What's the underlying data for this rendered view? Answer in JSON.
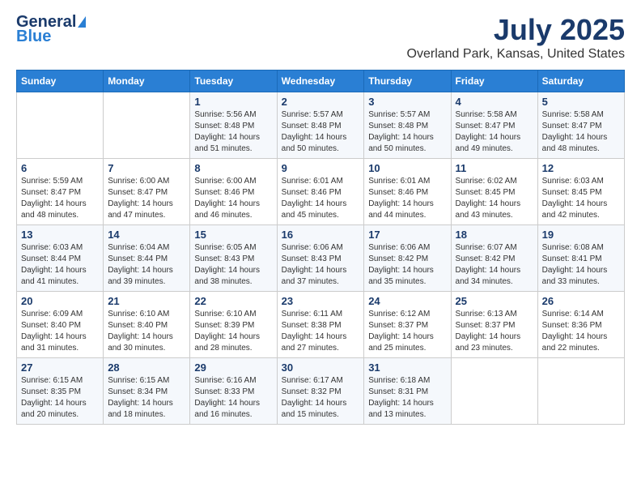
{
  "header": {
    "logo_general": "General",
    "logo_blue": "Blue",
    "title": "July 2025",
    "subtitle": "Overland Park, Kansas, United States"
  },
  "days_of_week": [
    "Sunday",
    "Monday",
    "Tuesday",
    "Wednesday",
    "Thursday",
    "Friday",
    "Saturday"
  ],
  "weeks": [
    [
      {
        "day": "",
        "info": ""
      },
      {
        "day": "",
        "info": ""
      },
      {
        "day": "1",
        "info": "Sunrise: 5:56 AM\nSunset: 8:48 PM\nDaylight: 14 hours and 51 minutes."
      },
      {
        "day": "2",
        "info": "Sunrise: 5:57 AM\nSunset: 8:48 PM\nDaylight: 14 hours and 50 minutes."
      },
      {
        "day": "3",
        "info": "Sunrise: 5:57 AM\nSunset: 8:48 PM\nDaylight: 14 hours and 50 minutes."
      },
      {
        "day": "4",
        "info": "Sunrise: 5:58 AM\nSunset: 8:47 PM\nDaylight: 14 hours and 49 minutes."
      },
      {
        "day": "5",
        "info": "Sunrise: 5:58 AM\nSunset: 8:47 PM\nDaylight: 14 hours and 48 minutes."
      }
    ],
    [
      {
        "day": "6",
        "info": "Sunrise: 5:59 AM\nSunset: 8:47 PM\nDaylight: 14 hours and 48 minutes."
      },
      {
        "day": "7",
        "info": "Sunrise: 6:00 AM\nSunset: 8:47 PM\nDaylight: 14 hours and 47 minutes."
      },
      {
        "day": "8",
        "info": "Sunrise: 6:00 AM\nSunset: 8:46 PM\nDaylight: 14 hours and 46 minutes."
      },
      {
        "day": "9",
        "info": "Sunrise: 6:01 AM\nSunset: 8:46 PM\nDaylight: 14 hours and 45 minutes."
      },
      {
        "day": "10",
        "info": "Sunrise: 6:01 AM\nSunset: 8:46 PM\nDaylight: 14 hours and 44 minutes."
      },
      {
        "day": "11",
        "info": "Sunrise: 6:02 AM\nSunset: 8:45 PM\nDaylight: 14 hours and 43 minutes."
      },
      {
        "day": "12",
        "info": "Sunrise: 6:03 AM\nSunset: 8:45 PM\nDaylight: 14 hours and 42 minutes."
      }
    ],
    [
      {
        "day": "13",
        "info": "Sunrise: 6:03 AM\nSunset: 8:44 PM\nDaylight: 14 hours and 41 minutes."
      },
      {
        "day": "14",
        "info": "Sunrise: 6:04 AM\nSunset: 8:44 PM\nDaylight: 14 hours and 39 minutes."
      },
      {
        "day": "15",
        "info": "Sunrise: 6:05 AM\nSunset: 8:43 PM\nDaylight: 14 hours and 38 minutes."
      },
      {
        "day": "16",
        "info": "Sunrise: 6:06 AM\nSunset: 8:43 PM\nDaylight: 14 hours and 37 minutes."
      },
      {
        "day": "17",
        "info": "Sunrise: 6:06 AM\nSunset: 8:42 PM\nDaylight: 14 hours and 35 minutes."
      },
      {
        "day": "18",
        "info": "Sunrise: 6:07 AM\nSunset: 8:42 PM\nDaylight: 14 hours and 34 minutes."
      },
      {
        "day": "19",
        "info": "Sunrise: 6:08 AM\nSunset: 8:41 PM\nDaylight: 14 hours and 33 minutes."
      }
    ],
    [
      {
        "day": "20",
        "info": "Sunrise: 6:09 AM\nSunset: 8:40 PM\nDaylight: 14 hours and 31 minutes."
      },
      {
        "day": "21",
        "info": "Sunrise: 6:10 AM\nSunset: 8:40 PM\nDaylight: 14 hours and 30 minutes."
      },
      {
        "day": "22",
        "info": "Sunrise: 6:10 AM\nSunset: 8:39 PM\nDaylight: 14 hours and 28 minutes."
      },
      {
        "day": "23",
        "info": "Sunrise: 6:11 AM\nSunset: 8:38 PM\nDaylight: 14 hours and 27 minutes."
      },
      {
        "day": "24",
        "info": "Sunrise: 6:12 AM\nSunset: 8:37 PM\nDaylight: 14 hours and 25 minutes."
      },
      {
        "day": "25",
        "info": "Sunrise: 6:13 AM\nSunset: 8:37 PM\nDaylight: 14 hours and 23 minutes."
      },
      {
        "day": "26",
        "info": "Sunrise: 6:14 AM\nSunset: 8:36 PM\nDaylight: 14 hours and 22 minutes."
      }
    ],
    [
      {
        "day": "27",
        "info": "Sunrise: 6:15 AM\nSunset: 8:35 PM\nDaylight: 14 hours and 20 minutes."
      },
      {
        "day": "28",
        "info": "Sunrise: 6:15 AM\nSunset: 8:34 PM\nDaylight: 14 hours and 18 minutes."
      },
      {
        "day": "29",
        "info": "Sunrise: 6:16 AM\nSunset: 8:33 PM\nDaylight: 14 hours and 16 minutes."
      },
      {
        "day": "30",
        "info": "Sunrise: 6:17 AM\nSunset: 8:32 PM\nDaylight: 14 hours and 15 minutes."
      },
      {
        "day": "31",
        "info": "Sunrise: 6:18 AM\nSunset: 8:31 PM\nDaylight: 14 hours and 13 minutes."
      },
      {
        "day": "",
        "info": ""
      },
      {
        "day": "",
        "info": ""
      }
    ]
  ]
}
